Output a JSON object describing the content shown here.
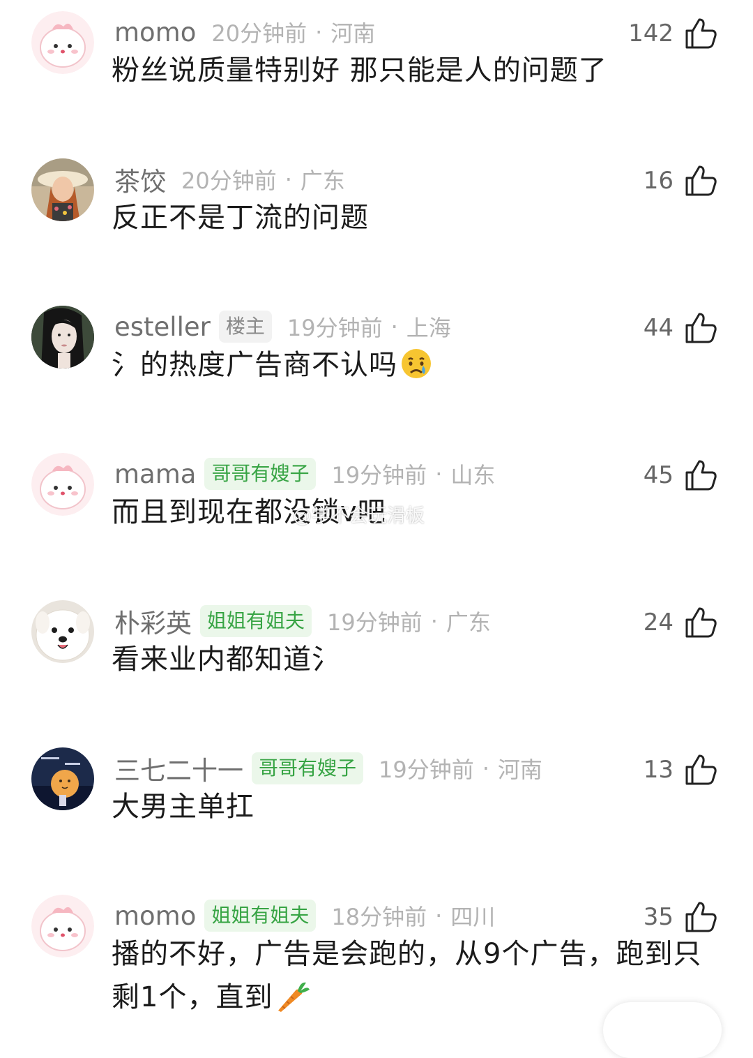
{
  "comments": [
    {
      "user": "momo",
      "badge": "",
      "time": "20分钟前",
      "dot": "·",
      "region": "河南",
      "likes": "142",
      "text": "粉丝说质量特别好 那只能是人的问题了",
      "avatar": "pink-blob-avatar"
    },
    {
      "user": "茶饺",
      "badge": "",
      "time": "20分钟前",
      "dot": "·",
      "region": "广东",
      "likes": "16",
      "text": "反正不是丁流的问题",
      "avatar": "photo-avatar"
    },
    {
      "user": "esteller",
      "badge": "楼主",
      "time": "19分钟前",
      "dot": "·",
      "region": "上海",
      "likes": "44",
      "text": "氵的热度广告商不认吗",
      "avatar": "photo-avatar",
      "emoji": "crying-face-emoji"
    },
    {
      "user": "mama",
      "badge": "哥哥有嫂子",
      "time": "19分钟前",
      "dot": "·",
      "region": "山东",
      "likes": "45",
      "text": "而且到现在都没锁v吧",
      "avatar": "pink-blob-avatar"
    },
    {
      "user": "朴彩英",
      "badge": "姐姐有姐夫",
      "time": "19分钟前",
      "dot": "·",
      "region": "广东",
      "likes": "24",
      "text": "看来业内都知道氵",
      "avatar": "dog-avatar"
    },
    {
      "user": "三七二十一",
      "badge": "哥哥有嫂子",
      "time": "19分钟前",
      "dot": "·",
      "region": "河南",
      "likes": "13",
      "text": "大男主单扛",
      "avatar": "night-scene-avatar"
    },
    {
      "user": "momo",
      "badge": "姐姐有姐夫",
      "time": "18分钟前",
      "dot": "·",
      "region": "四川",
      "likes": "35",
      "text": "播的不好，广告是会跑的，从9个广告，跑到只剩1个，直到",
      "avatar": "pink-blob-avatar",
      "emoji": "carrot-emoji"
    }
  ],
  "watermark": "@学不会玩滑板",
  "colors": {
    "username": "#6f6f6f",
    "meta": "#b3b3b3",
    "text": "#1b1b1b",
    "badge_green_bg": "#ebf7ea",
    "badge_green_text": "#37a444",
    "badge_owner_bg": "#f2f2f2",
    "badge_owner_text": "#8a8a8a"
  }
}
